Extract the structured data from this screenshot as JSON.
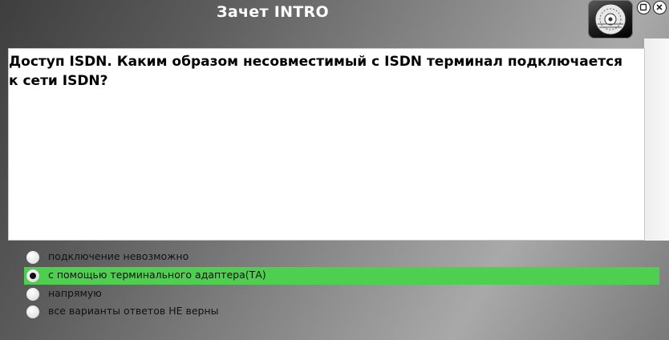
{
  "window": {
    "title": "Зачет INTRO",
    "logo_icon": "disc-logo-icon",
    "minimize_icon": "minimize-icon",
    "close_icon": "close-icon"
  },
  "question": {
    "text": "Доступ ISDN. Каким образом несовместимый с ISDN терминал подключается к сети ISDN?"
  },
  "answers": [
    {
      "label": "подключение невозможно",
      "selected": false
    },
    {
      "label": "с помощью терминального адаптера(ТА)",
      "selected": true
    },
    {
      "label": "напрямую",
      "selected": false
    },
    {
      "label": "все варианты ответов НЕ верны",
      "selected": false
    }
  ],
  "colors": {
    "selected_answer": "#4fcf4f",
    "title_text": "#ffffff"
  }
}
